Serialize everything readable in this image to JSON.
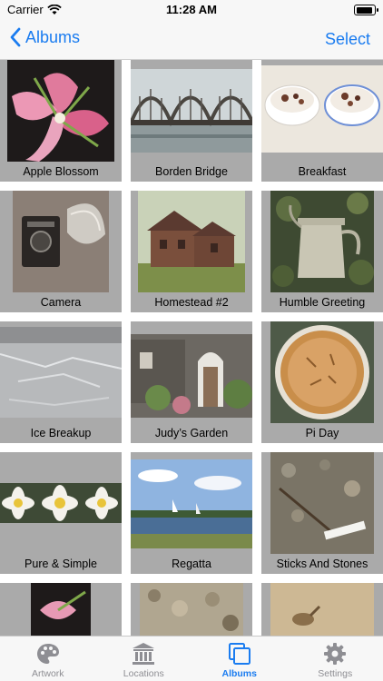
{
  "status": {
    "carrier": "Carrier",
    "time": "11:28 AM",
    "battery_level": 0.95
  },
  "nav": {
    "back_label": "Albums",
    "action_label": "Select"
  },
  "albums": [
    {
      "title": "Apple Blossom"
    },
    {
      "title": "Borden Bridge"
    },
    {
      "title": "Breakfast"
    },
    {
      "title": "Camera"
    },
    {
      "title": "Homestead #2"
    },
    {
      "title": "Humble Greeting"
    },
    {
      "title": "Ice Breakup"
    },
    {
      "title": "Judy’s Garden"
    },
    {
      "title": "Pi Day"
    },
    {
      "title": "Pure & Simple"
    },
    {
      "title": "Regatta"
    },
    {
      "title": "Sticks And Stones"
    },
    {
      "title": ""
    },
    {
      "title": ""
    },
    {
      "title": ""
    }
  ],
  "tabs": [
    {
      "label": "Artwork",
      "icon": "palette-icon",
      "active": false
    },
    {
      "label": "Locations",
      "icon": "museum-icon",
      "active": false
    },
    {
      "label": "Albums",
      "icon": "albums-icon",
      "active": true
    },
    {
      "label": "Settings",
      "icon": "gear-icon",
      "active": false
    }
  ],
  "colors": {
    "accent": "#1a7cf0",
    "tile_background": "#aaaaaa",
    "inactive_tab": "#8e8e93"
  }
}
